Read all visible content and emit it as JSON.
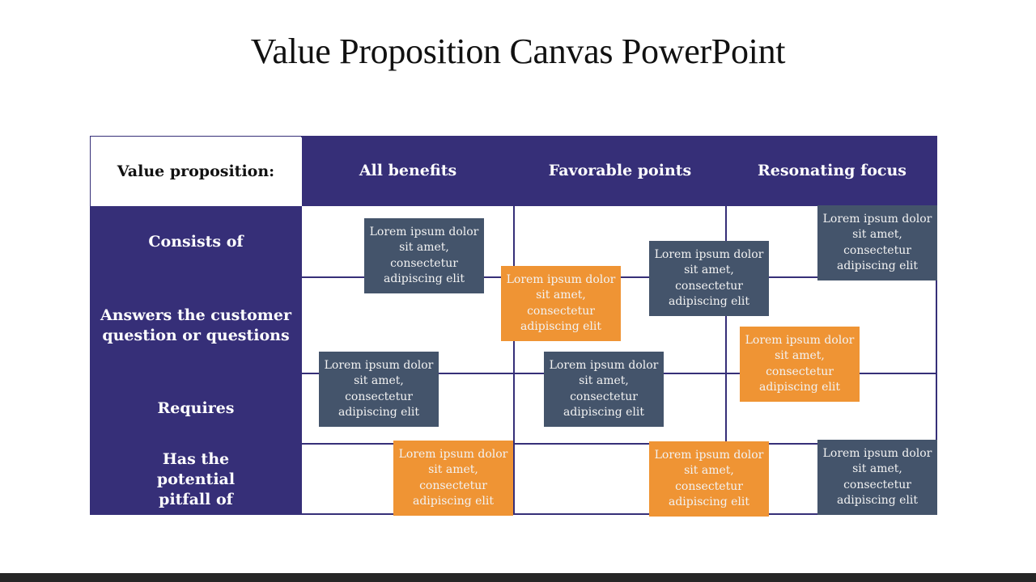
{
  "slide": {
    "title": "Value Proposition Canvas PowerPoint",
    "colors": {
      "primary": "#362f78",
      "card_slate": "#44546b",
      "card_orange": "#ef9434",
      "footer": "#262626"
    }
  },
  "table": {
    "corner_label": "Value proposition:",
    "columns": [
      "All benefits",
      "Favorable points",
      "Resonating focus"
    ],
    "rows": [
      "Consists of",
      "Answers the customer question or questions",
      "Requires",
      "Has the potential pitfall of"
    ]
  },
  "cards": [
    {
      "text": "Lorem ipsum dolor sit amet, consectetur adipiscing elit",
      "color": "slate",
      "column": "All benefits",
      "row": "Consists of"
    },
    {
      "text": "Lorem ipsum dolor sit amet, consectetur adipiscing elit",
      "color": "orange",
      "column": "All benefits / Favorable points",
      "row": "Consists of / Answers"
    },
    {
      "text": "Lorem ipsum dolor sit amet, consectetur adipiscing elit",
      "color": "slate",
      "column": "Favorable points / Resonating focus",
      "row": "Consists of / Answers"
    },
    {
      "text": "Lorem ipsum dolor sit amet, consectetur adipiscing elit",
      "color": "slate",
      "column": "Resonating focus",
      "row": "Consists of"
    },
    {
      "text": "Lorem ipsum dolor sit amet, consectetur adipiscing elit",
      "color": "orange",
      "column": "Resonating focus",
      "row": "Answers / Requires"
    },
    {
      "text": "Lorem ipsum dolor sit amet, consectetur adipiscing elit",
      "color": "slate",
      "column": "All benefits",
      "row": "Answers / Requires"
    },
    {
      "text": "Lorem ipsum dolor sit amet, consectetur adipiscing elit",
      "color": "slate",
      "column": "Favorable points",
      "row": "Answers / Requires"
    },
    {
      "text": "Lorem ipsum dolor sit amet, consectetur adipiscing elit",
      "color": "orange",
      "column": "All benefits",
      "row": "Has the potential pitfall of"
    },
    {
      "text": "Lorem ipsum dolor sit amet, consectetur adipiscing elit",
      "color": "orange",
      "column": "Favorable points / Resonating focus",
      "row": "Has the potential pitfall of"
    },
    {
      "text": "Lorem ipsum dolor sit amet, consectetur adipiscing elit",
      "color": "slate",
      "column": "Resonating focus",
      "row": "Has the potential pitfall of"
    }
  ]
}
